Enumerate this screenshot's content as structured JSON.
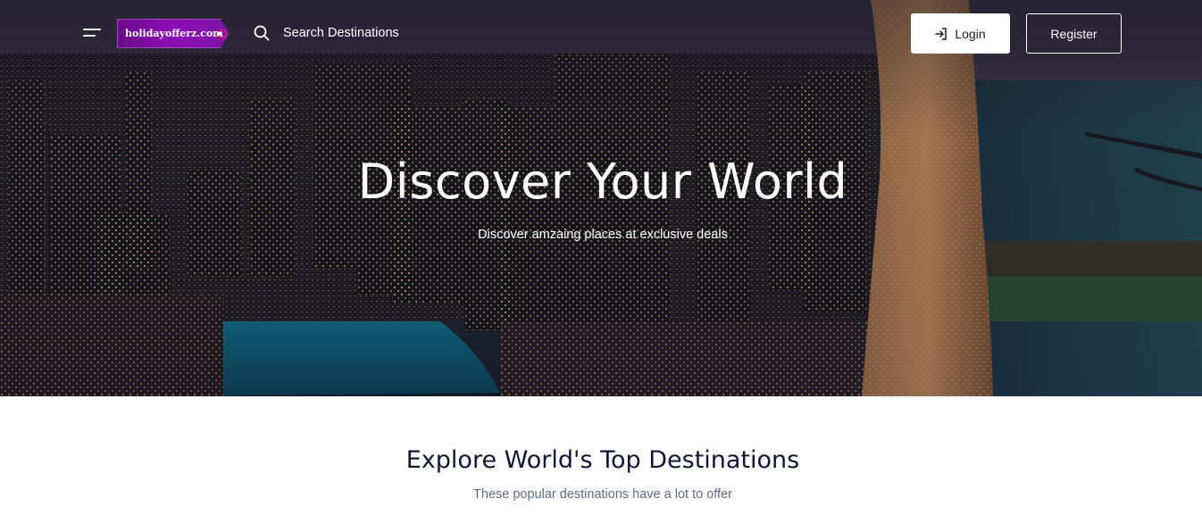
{
  "header": {
    "logo_text": "holidayofferz.com",
    "search_label": "Search Destinations",
    "login_label": "Login",
    "register_label": "Register",
    "icons": [
      "menu-icon",
      "search-icon",
      "login-icon"
    ]
  },
  "hero": {
    "title": "Discover Your World",
    "subtitle": "Discover amzaing places at exclusive deals"
  },
  "destinations": {
    "title": "Explore World's Top Destinations",
    "subtitle": "These popular destinations have a lot to offer"
  },
  "colors": {
    "logo_bg": "#8e0fb5",
    "heading": "#101736",
    "subtext": "#5c6b86",
    "button_text": "#1a1d2b"
  }
}
